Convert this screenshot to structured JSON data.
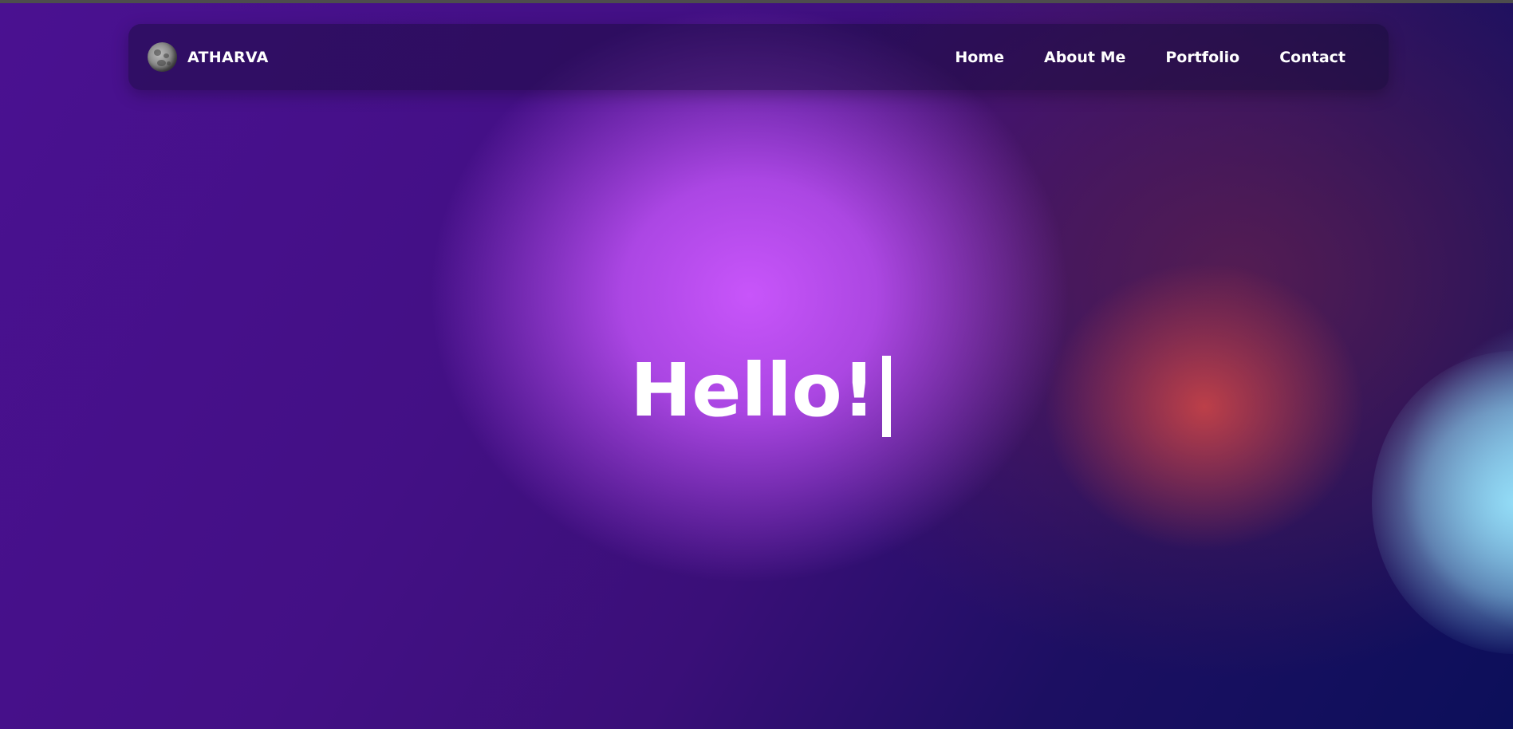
{
  "brand": {
    "name": "ATHARVA",
    "avatar_icon": "moon-icon"
  },
  "nav": {
    "items": [
      {
        "label": "Home"
      },
      {
        "label": "About Me"
      },
      {
        "label": "Portfolio"
      },
      {
        "label": "Contact"
      }
    ]
  },
  "hero": {
    "greeting": "Hello!"
  },
  "colors": {
    "background_primary": "#4a1191",
    "glow_pink": "#c055f5",
    "glow_red": "#d24646",
    "glow_cyan": "#8cdcff",
    "text": "#ffffff"
  }
}
